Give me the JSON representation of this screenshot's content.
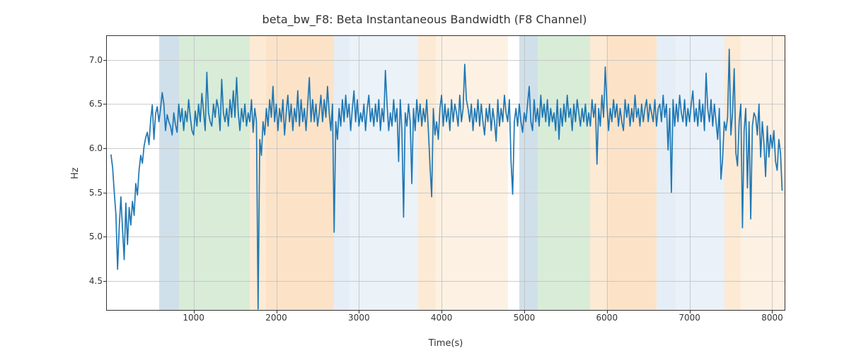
{
  "chart_data": {
    "type": "line",
    "title": "beta_bw_F8: Beta Instantaneous Bandwidth (F8 Channel)",
    "xlabel": "Time(s)",
    "ylabel": "Hz",
    "xlim": [
      -50,
      8150
    ],
    "ylim": [
      4.17,
      7.27
    ],
    "xticks": [
      1000,
      2000,
      3000,
      4000,
      5000,
      6000,
      7000,
      8000
    ],
    "yticks": [
      4.5,
      5.0,
      5.5,
      6.0,
      6.5,
      7.0
    ],
    "line_color": "#1f77b4",
    "grid": true,
    "bands": [
      {
        "x0": 580,
        "x1": 820,
        "color": "#a9c7d9",
        "alpha": 0.55
      },
      {
        "x0": 820,
        "x1": 1680,
        "color": "#b8ddb8",
        "alpha": 0.55
      },
      {
        "x0": 1680,
        "x1": 1880,
        "color": "#fcd9b0",
        "alpha": 0.55
      },
      {
        "x0": 1880,
        "x1": 2700,
        "color": "#fac892",
        "alpha": 0.5
      },
      {
        "x0": 2700,
        "x1": 2890,
        "color": "#cfe0ef",
        "alpha": 0.55
      },
      {
        "x0": 2890,
        "x1": 3720,
        "color": "#d8e6f2",
        "alpha": 0.5
      },
      {
        "x0": 3720,
        "x1": 3930,
        "color": "#fcd9b0",
        "alpha": 0.55
      },
      {
        "x0": 3930,
        "x1": 4800,
        "color": "#fce6cc",
        "alpha": 0.55
      },
      {
        "x0": 4940,
        "x1": 5160,
        "color": "#a9c7d9",
        "alpha": 0.55
      },
      {
        "x0": 5160,
        "x1": 5800,
        "color": "#b8ddb8",
        "alpha": 0.55
      },
      {
        "x0": 5800,
        "x1": 5990,
        "color": "#fcd9b0",
        "alpha": 0.55
      },
      {
        "x0": 5990,
        "x1": 6600,
        "color": "#fac892",
        "alpha": 0.5
      },
      {
        "x0": 6600,
        "x1": 6830,
        "color": "#cfe0ef",
        "alpha": 0.55
      },
      {
        "x0": 6830,
        "x1": 7420,
        "color": "#d8e6f2",
        "alpha": 0.55
      },
      {
        "x0": 7420,
        "x1": 7620,
        "color": "#fcd9b0",
        "alpha": 0.55
      },
      {
        "x0": 7620,
        "x1": 8150,
        "color": "#fce6cc",
        "alpha": 0.55
      }
    ],
    "x": [
      0,
      20,
      40,
      60,
      80,
      100,
      120,
      140,
      160,
      180,
      200,
      220,
      240,
      260,
      280,
      300,
      320,
      340,
      360,
      380,
      400,
      420,
      440,
      460,
      480,
      500,
      520,
      540,
      560,
      580,
      600,
      620,
      640,
      660,
      680,
      700,
      720,
      740,
      760,
      780,
      800,
      820,
      840,
      860,
      880,
      900,
      920,
      940,
      960,
      980,
      1000,
      1020,
      1040,
      1060,
      1080,
      1100,
      1120,
      1140,
      1160,
      1180,
      1200,
      1220,
      1240,
      1260,
      1280,
      1300,
      1320,
      1340,
      1360,
      1380,
      1400,
      1420,
      1440,
      1460,
      1480,
      1500,
      1520,
      1540,
      1560,
      1580,
      1600,
      1620,
      1640,
      1660,
      1680,
      1700,
      1720,
      1740,
      1760,
      1780,
      1800,
      1820,
      1840,
      1860,
      1880,
      1900,
      1920,
      1940,
      1960,
      1980,
      2000,
      2020,
      2040,
      2060,
      2080,
      2100,
      2120,
      2140,
      2160,
      2180,
      2200,
      2220,
      2240,
      2260,
      2280,
      2300,
      2320,
      2340,
      2360,
      2380,
      2400,
      2420,
      2440,
      2460,
      2480,
      2500,
      2520,
      2540,
      2560,
      2580,
      2600,
      2620,
      2640,
      2660,
      2680,
      2700,
      2720,
      2740,
      2760,
      2780,
      2800,
      2820,
      2840,
      2860,
      2880,
      2900,
      2920,
      2940,
      2960,
      2980,
      3000,
      3020,
      3040,
      3060,
      3080,
      3100,
      3120,
      3140,
      3160,
      3180,
      3200,
      3220,
      3240,
      3260,
      3280,
      3300,
      3320,
      3340,
      3360,
      3380,
      3400,
      3420,
      3440,
      3460,
      3480,
      3500,
      3520,
      3540,
      3560,
      3580,
      3600,
      3620,
      3640,
      3660,
      3680,
      3700,
      3720,
      3740,
      3760,
      3780,
      3800,
      3820,
      3840,
      3860,
      3880,
      3900,
      3920,
      3940,
      3960,
      3980,
      4000,
      4020,
      4040,
      4060,
      4080,
      4100,
      4120,
      4140,
      4160,
      4180,
      4200,
      4220,
      4240,
      4260,
      4280,
      4300,
      4320,
      4340,
      4360,
      4380,
      4400,
      4420,
      4440,
      4460,
      4480,
      4500,
      4520,
      4540,
      4560,
      4580,
      4600,
      4620,
      4640,
      4660,
      4680,
      4700,
      4720,
      4740,
      4760,
      4780,
      4800,
      4820,
      4840,
      4860,
      4880,
      4900,
      4920,
      4940,
      4960,
      4980,
      5000,
      5020,
      5040,
      5060,
      5080,
      5100,
      5120,
      5140,
      5160,
      5180,
      5200,
      5220,
      5240,
      5260,
      5280,
      5300,
      5320,
      5340,
      5360,
      5380,
      5400,
      5420,
      5440,
      5460,
      5480,
      5500,
      5520,
      5540,
      5560,
      5580,
      5600,
      5620,
      5640,
      5660,
      5680,
      5700,
      5720,
      5740,
      5760,
      5780,
      5800,
      5820,
      5840,
      5860,
      5880,
      5900,
      5920,
      5940,
      5960,
      5980,
      6000,
      6020,
      6040,
      6060,
      6080,
      6100,
      6120,
      6140,
      6160,
      6180,
      6200,
      6220,
      6240,
      6260,
      6280,
      6300,
      6320,
      6340,
      6360,
      6380,
      6400,
      6420,
      6440,
      6460,
      6480,
      6500,
      6520,
      6540,
      6560,
      6580,
      6600,
      6620,
      6640,
      6660,
      6680,
      6700,
      6720,
      6740,
      6760,
      6780,
      6800,
      6820,
      6840,
      6860,
      6880,
      6900,
      6920,
      6940,
      6960,
      6980,
      7000,
      7020,
      7040,
      7060,
      7080,
      7100,
      7120,
      7140,
      7160,
      7180,
      7200,
      7220,
      7240,
      7260,
      7280,
      7300,
      7320,
      7340,
      7360,
      7380,
      7400,
      7420,
      7440,
      7460,
      7480,
      7500,
      7520,
      7540,
      7560,
      7580,
      7600,
      7620,
      7640,
      7660,
      7680,
      7700,
      7720,
      7740,
      7760,
      7780,
      7800,
      7820,
      7840,
      7860,
      7880,
      7900,
      7920,
      7940,
      7960,
      7980,
      8000,
      8020,
      8040,
      8060,
      8080,
      8100,
      8120
    ],
    "values": [
      5.93,
      5.78,
      5.5,
      5.25,
      4.63,
      5.11,
      5.45,
      5.08,
      4.74,
      5.38,
      4.91,
      5.33,
      5.13,
      5.4,
      5.24,
      5.6,
      5.47,
      5.75,
      5.92,
      5.83,
      6.02,
      6.12,
      6.18,
      6.04,
      6.32,
      6.49,
      6.1,
      6.39,
      6.47,
      6.3,
      6.45,
      6.63,
      6.5,
      6.2,
      6.38,
      6.3,
      6.25,
      6.15,
      6.4,
      6.27,
      6.18,
      6.5,
      6.3,
      6.45,
      6.2,
      6.42,
      6.3,
      6.55,
      6.35,
      6.2,
      6.15,
      6.42,
      6.25,
      6.5,
      6.3,
      6.62,
      6.42,
      6.2,
      6.86,
      6.4,
      6.3,
      6.25,
      6.5,
      6.35,
      6.55,
      6.45,
      6.2,
      6.78,
      6.4,
      6.3,
      6.45,
      6.25,
      6.55,
      6.35,
      6.65,
      6.35,
      6.8,
      6.4,
      6.2,
      6.45,
      6.3,
      6.5,
      6.25,
      6.4,
      6.3,
      6.55,
      6.18,
      6.45,
      6.3,
      4.18,
      6.1,
      5.92,
      6.3,
      6.15,
      6.45,
      6.25,
      6.55,
      6.35,
      6.7,
      6.3,
      6.5,
      6.2,
      6.45,
      6.3,
      6.55,
      6.15,
      6.4,
      6.6,
      6.3,
      6.5,
      6.2,
      6.45,
      6.3,
      6.65,
      6.25,
      6.55,
      6.3,
      6.45,
      6.2,
      6.5,
      6.8,
      6.3,
      6.55,
      6.3,
      6.5,
      6.25,
      6.4,
      6.6,
      6.3,
      6.55,
      6.35,
      6.7,
      6.4,
      6.2,
      6.5,
      5.05,
      6.3,
      6.1,
      6.45,
      6.25,
      6.55,
      6.3,
      6.6,
      6.35,
      6.5,
      6.2,
      6.45,
      6.65,
      6.3,
      6.55,
      6.25,
      6.4,
      6.3,
      6.5,
      6.2,
      6.45,
      6.6,
      6.3,
      6.45,
      6.25,
      6.5,
      6.3,
      6.55,
      6.2,
      6.45,
      6.3,
      6.88,
      6.5,
      6.2,
      6.4,
      6.25,
      6.55,
      6.3,
      6.45,
      5.85,
      6.55,
      6.2,
      5.22,
      6.4,
      6.25,
      6.5,
      6.3,
      5.6,
      6.45,
      6.2,
      6.55,
      6.3,
      6.5,
      6.25,
      6.45,
      6.3,
      6.55,
      6.2,
      5.8,
      5.45,
      6.45,
      6.15,
      6.3,
      6.1,
      6.45,
      6.6,
      6.25,
      6.5,
      6.3,
      6.45,
      6.2,
      6.55,
      6.3,
      6.5,
      6.4,
      6.25,
      6.6,
      6.3,
      6.45,
      6.95,
      6.55,
      6.45,
      6.3,
      6.5,
      6.2,
      6.45,
      6.3,
      6.55,
      6.25,
      6.5,
      6.3,
      6.15,
      6.45,
      6.3,
      6.5,
      6.2,
      6.45,
      6.3,
      6.08,
      6.55,
      6.25,
      6.45,
      6.3,
      6.6,
      6.4,
      6.3,
      6.55,
      5.85,
      5.48,
      6.3,
      6.45,
      6.25,
      6.5,
      6.3,
      6.18,
      6.4,
      6.3,
      6.5,
      6.7,
      6.3,
      6.2,
      6.55,
      6.3,
      6.45,
      6.25,
      6.6,
      6.35,
      6.5,
      6.3,
      6.55,
      6.25,
      6.45,
      6.3,
      6.4,
      6.2,
      6.55,
      6.1,
      6.45,
      6.25,
      6.5,
      6.3,
      6.6,
      6.35,
      6.45,
      6.2,
      6.5,
      6.3,
      6.55,
      6.4,
      6.25,
      6.45,
      6.3,
      6.5,
      6.25,
      6.4,
      6.25,
      6.55,
      6.35,
      6.5,
      5.82,
      6.45,
      6.25,
      6.6,
      6.35,
      6.92,
      6.5,
      6.2,
      6.45,
      6.3,
      6.55,
      6.35,
      6.5,
      6.25,
      6.45,
      6.3,
      6.2,
      6.55,
      6.35,
      6.5,
      6.25,
      6.45,
      6.3,
      6.6,
      6.35,
      6.45,
      6.25,
      6.5,
      6.3,
      6.45,
      6.55,
      6.3,
      6.5,
      6.4,
      6.3,
      6.55,
      6.25,
      6.45,
      6.5,
      6.3,
      6.6,
      6.35,
      6.5,
      5.98,
      6.45,
      5.5,
      6.55,
      6.25,
      6.5,
      6.3,
      6.6,
      6.4,
      6.3,
      6.55,
      6.25,
      6.45,
      6.3,
      6.5,
      6.65,
      6.3,
      6.45,
      6.25,
      6.55,
      6.3,
      6.5,
      6.2,
      6.85,
      6.45,
      6.3,
      6.55,
      6.25,
      6.5,
      6.3,
      6.1,
      6.45,
      5.65,
      5.88,
      6.3,
      6.2,
      6.35,
      7.12,
      6.15,
      6.4,
      6.9,
      5.95,
      5.8,
      6.3,
      6.5,
      5.1,
      6.2,
      6.45,
      5.55,
      6.3,
      5.2,
      6.25,
      6.4,
      6.35,
      6.15,
      6.5,
      5.9,
      6.3,
      6.05,
      5.68,
      6.25,
      5.9,
      6.15,
      6.0,
      6.2,
      5.85,
      5.75,
      6.1,
      5.95,
      5.52
    ]
  }
}
